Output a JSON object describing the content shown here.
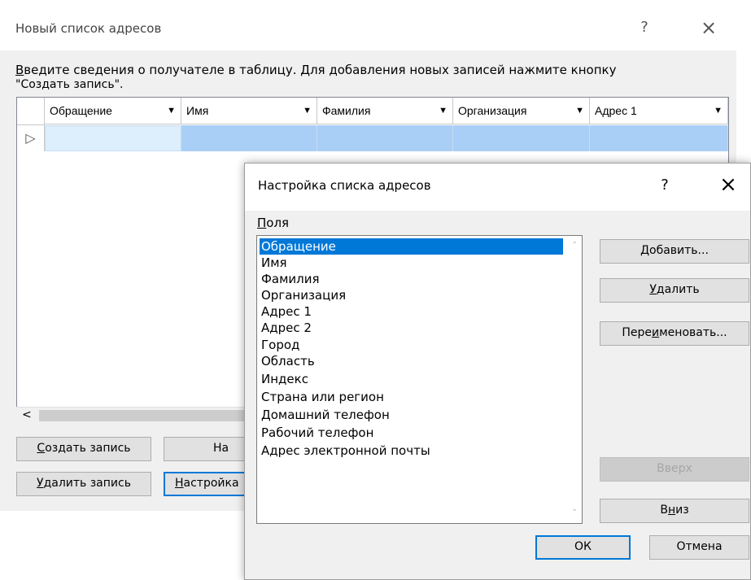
{
  "main": {
    "title": "Новый список адресов",
    "help": "?",
    "close": "×",
    "instruction_first": "В",
    "instruction_rest": "ведите сведения о получателе в таблицу. Для добавления новых записей нажмите кнопку",
    "instruction_line2": "\"Создать запись\".",
    "columns": [
      "Обращение",
      "Имя",
      "Фамилия",
      "Организация",
      "Адрес 1"
    ],
    "row_marker": "▷",
    "scroll_left": "<",
    "buttons": {
      "create_u": "С",
      "create_rest": "оздать запись",
      "find": "На",
      "delete_u": "У",
      "delete_rest": "далить запись",
      "setup_u": "Н",
      "setup_rest": "астройка"
    }
  },
  "dialog": {
    "title": "Настройка списка адресов",
    "help": "?",
    "close": "×",
    "fields_u": "П",
    "fields_rest": "оля",
    "items": [
      "Обращение",
      "Имя",
      "Фамилия",
      "Организация",
      "Адрес 1",
      "Адрес 2",
      "Город",
      "Область",
      "Индекс",
      "Страна или регион",
      "Домашний телефон",
      "Рабочий телефон",
      "Адрес электронной почты"
    ],
    "selected_index": 0,
    "buttons": {
      "add_u": "Д",
      "add_rest": "обавить...",
      "remove_u": "У",
      "remove_rest": "далить",
      "rename_a": "Пере",
      "rename_u": "и",
      "rename_b": "меновать...",
      "up": "Вверх",
      "down_a": "В",
      "down_u": "н",
      "down_b": "из",
      "ok": "ОК",
      "cancel": "Отмена"
    }
  },
  "colors": {
    "accent": "#0078d7",
    "row_highlight": "#a9cff7"
  }
}
